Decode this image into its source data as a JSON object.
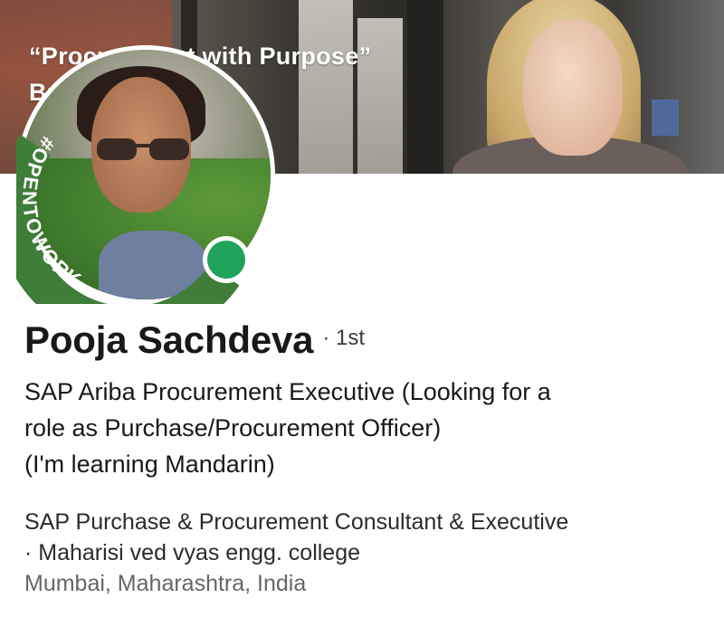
{
  "banner": {
    "line1": "“Procurement with Purpose”",
    "line2": "Brand Roundtable"
  },
  "avatar": {
    "badge_text": "#OPENTOWORK",
    "badge_color": "#3f7d3a",
    "online_color": "#1fa35b"
  },
  "profile": {
    "name": "Pooja Sachdeva",
    "degree": "· 1st",
    "headline_lines": [
      "SAP Ariba Procurement Executive (Looking for a",
      "role as Purchase/Procurement Officer)",
      "(I'm learning Mandarin)"
    ],
    "current_position_line1": "SAP Purchase & Procurement Consultant & Executive",
    "current_position_line2": "· Maharisi ved vyas engg. college",
    "location": "Mumbai, Maharashtra, India"
  }
}
